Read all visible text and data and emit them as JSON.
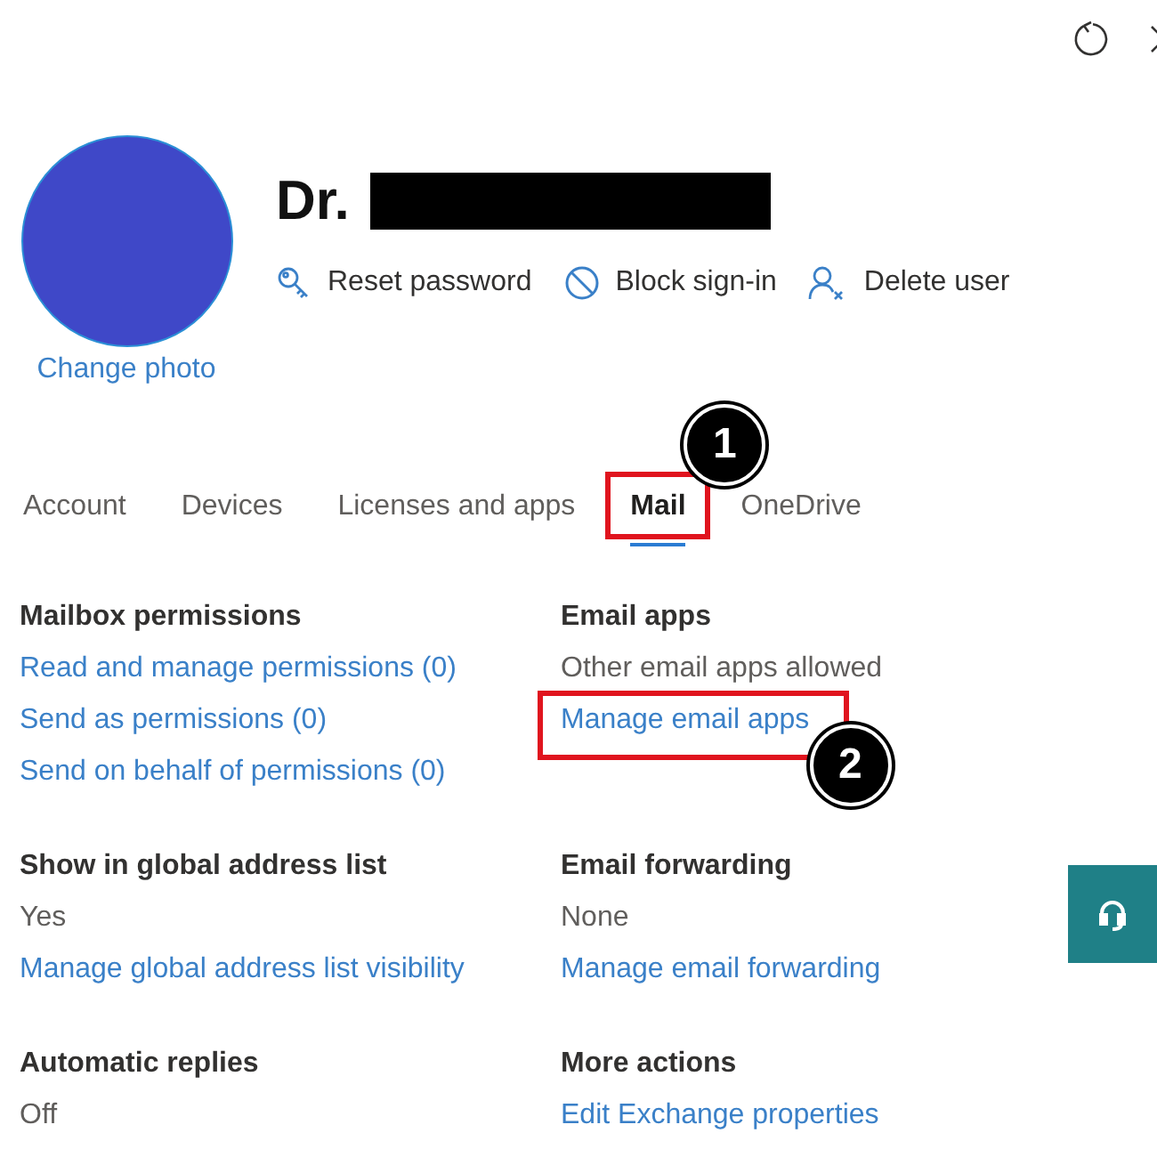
{
  "user": {
    "name": "Dr.",
    "photo_link": "Change photo"
  },
  "actions": [
    {
      "kind": "key",
      "label": "Reset password"
    },
    {
      "kind": "block",
      "label": "Block sign-in"
    },
    {
      "kind": "person-remove",
      "label": "Delete user"
    }
  ],
  "tabs": [
    {
      "label": "Account",
      "selected": false,
      "highlighted": false
    },
    {
      "label": "Devices",
      "selected": false,
      "highlighted": false
    },
    {
      "label": "Licenses and apps",
      "selected": false,
      "highlighted": false
    },
    {
      "label": "Mail",
      "selected": true,
      "highlighted": true,
      "callout": "1"
    },
    {
      "label": "OneDrive",
      "selected": false,
      "highlighted": false
    }
  ],
  "sections": [
    {
      "heading": "Mailbox permissions",
      "links": [
        {
          "label": "Read and manage permissions (0)",
          "highlighted": false
        },
        {
          "label": "Send as permissions (0)",
          "highlighted": false
        },
        {
          "label": "Send on behalf of permissions (0)",
          "highlighted": false
        }
      ]
    },
    {
      "heading": "Email apps",
      "value": "Other email apps allowed",
      "links": [
        {
          "label": "Manage email apps",
          "highlighted": true,
          "callout": "2"
        }
      ]
    },
    {
      "heading": "Show in global address list",
      "value": "Yes",
      "links": [
        {
          "label": "Manage global address list visibility",
          "highlighted": false
        }
      ]
    },
    {
      "heading": "Email forwarding",
      "value": "None",
      "links": [
        {
          "label": "Manage email forwarding",
          "highlighted": false
        }
      ]
    },
    {
      "heading": "Automatic replies",
      "value": "Off"
    },
    {
      "heading": "More actions",
      "links": [
        {
          "label": "Edit Exchange properties",
          "highlighted": false
        }
      ]
    }
  ]
}
